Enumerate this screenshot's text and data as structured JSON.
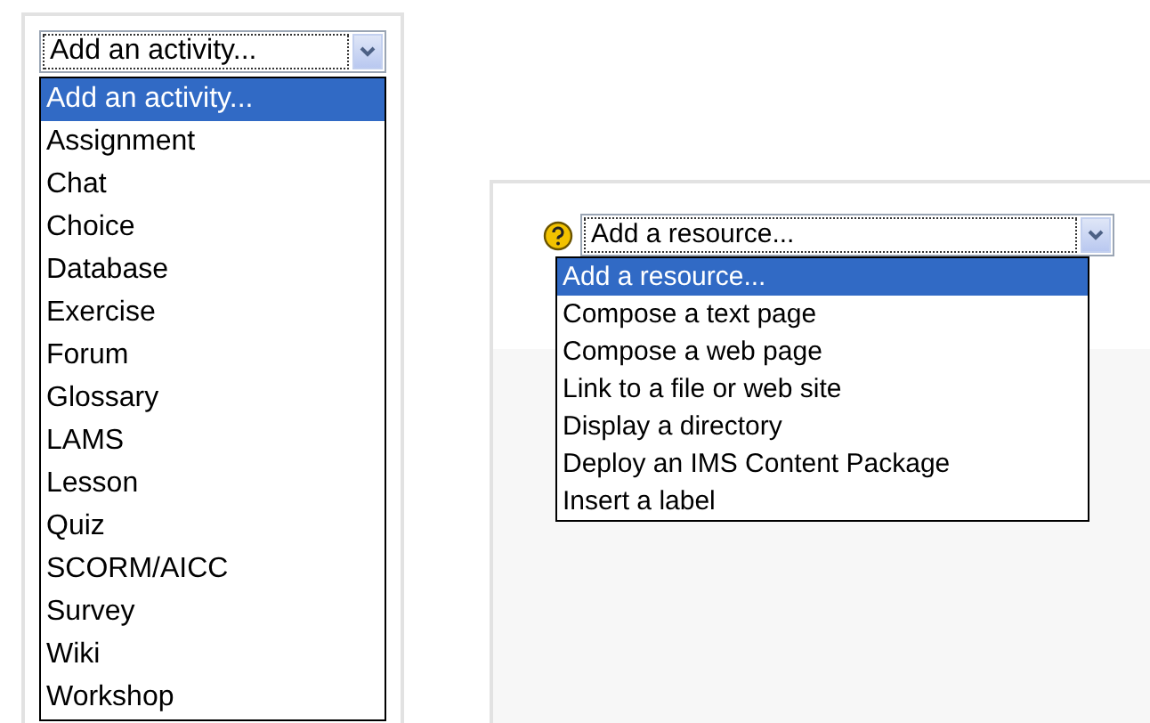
{
  "activity_select": {
    "value": "Add an activity...",
    "options": [
      {
        "label": "Add an activity...",
        "selected": true
      },
      {
        "label": "Assignment",
        "selected": false
      },
      {
        "label": "Chat",
        "selected": false
      },
      {
        "label": "Choice",
        "selected": false
      },
      {
        "label": "Database",
        "selected": false
      },
      {
        "label": "Exercise",
        "selected": false
      },
      {
        "label": "Forum",
        "selected": false
      },
      {
        "label": "Glossary",
        "selected": false
      },
      {
        "label": "LAMS",
        "selected": false
      },
      {
        "label": "Lesson",
        "selected": false
      },
      {
        "label": "Quiz",
        "selected": false
      },
      {
        "label": "SCORM/AICC",
        "selected": false
      },
      {
        "label": "Survey",
        "selected": false
      },
      {
        "label": "Wiki",
        "selected": false
      },
      {
        "label": "Workshop",
        "selected": false
      }
    ]
  },
  "resource_select": {
    "value": "Add a resource...",
    "options": [
      {
        "label": "Add a resource...",
        "selected": true
      },
      {
        "label": "Compose a text page",
        "selected": false
      },
      {
        "label": "Compose a web page",
        "selected": false
      },
      {
        "label": "Link to a file or web site",
        "selected": false
      },
      {
        "label": "Display a directory",
        "selected": false
      },
      {
        "label": "Deploy an IMS Content Package",
        "selected": false
      },
      {
        "label": "Insert a label",
        "selected": false
      }
    ]
  }
}
